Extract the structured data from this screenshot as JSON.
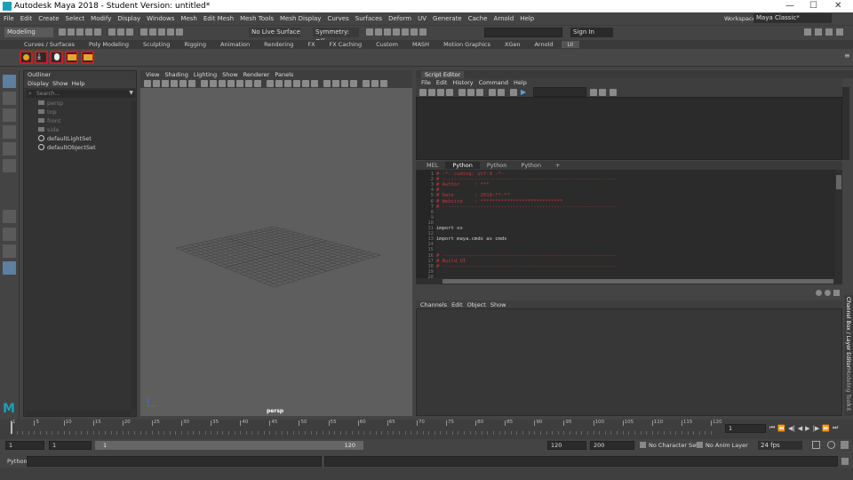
{
  "window": {
    "title": "Autodesk Maya 2018 - Student Version: untitled*"
  },
  "menubar": [
    "File",
    "Edit",
    "Create",
    "Select",
    "Modify",
    "Display",
    "Windows",
    "Mesh",
    "Edit Mesh",
    "Mesh Tools",
    "Mesh Display",
    "Curves",
    "Surfaces",
    "Deform",
    "UV",
    "Generate",
    "Cache",
    "Arnold",
    "Help"
  ],
  "workspace": {
    "label": "Workspace :",
    "value": "Maya Classic*"
  },
  "statusline": {
    "mode": "Modeling",
    "live_surface": "No Live Surface",
    "symmetry": "Symmetry: Off",
    "sign_in": "Sign In"
  },
  "shelf_tabs": [
    "Curves / Surfaces",
    "Poly Modeling",
    "Sculpting",
    "Rigging",
    "Animation",
    "Rendering",
    "FX",
    "FX Caching",
    "Custom",
    "MASH",
    "Motion Graphics",
    "XGen",
    "Arnold",
    "UI"
  ],
  "shelf_active_tab": "UI",
  "outliner": {
    "title": "Outliner",
    "menu": [
      "Display",
      "Show",
      "Help"
    ],
    "search_placeholder": "Search...",
    "items": [
      "persp",
      "top",
      "front",
      "side",
      "defaultLightSet",
      "defaultObjectSet"
    ]
  },
  "viewport": {
    "menu": [
      "View",
      "Shading",
      "Lighting",
      "Show",
      "Renderer",
      "Panels"
    ],
    "camera_label": "persp"
  },
  "script_editor": {
    "title": "Script Editor",
    "menu": [
      "File",
      "Edit",
      "History",
      "Command",
      "Help"
    ],
    "tabs": [
      "MEL",
      "Python",
      "Python",
      "Python",
      "+"
    ],
    "active_tab": 1,
    "line_numbers": [
      "1",
      "2",
      "3",
      "4",
      "5",
      "6",
      "7",
      "8",
      "9",
      "10",
      "11",
      "12",
      "13",
      "14",
      "15",
      "16",
      "17",
      "18",
      "19",
      "20",
      "21"
    ],
    "code": [
      {
        "text": "# -*- coding: utf-8 -*-",
        "color": "red"
      },
      {
        "text": "# -----------------------------------------------------------",
        "color": "red"
      },
      {
        "text": "# Author     : ***",
        "color": "red"
      },
      {
        "text": "#",
        "color": "red"
      },
      {
        "text": "# Date       : 2018-**-**",
        "color": "red"
      },
      {
        "text": "# Website    : ****************************",
        "color": "red"
      },
      {
        "text": "# -----------------------------------------------------------",
        "color": "red"
      },
      {
        "text": "",
        "color": "white"
      },
      {
        "text": "",
        "color": "white"
      },
      {
        "text": "",
        "color": "white"
      },
      {
        "text": "import os",
        "color": "white"
      },
      {
        "text": "",
        "color": "white"
      },
      {
        "text": "import maya.cmds as cmds",
        "color": "white"
      },
      {
        "text": "",
        "color": "white"
      },
      {
        "text": "",
        "color": "white"
      },
      {
        "text": "# -----------------------------------------------------------",
        "color": "red"
      },
      {
        "text": "# Build UI",
        "color": "red"
      },
      {
        "text": "# -----------------------------------------------------------",
        "color": "red"
      }
    ]
  },
  "channel_box": {
    "menu": [
      "Channels",
      "Edit",
      "Object",
      "Show"
    ],
    "side_tabs": [
      "Channel Box / Layer Editor",
      "Modeling Toolkit"
    ]
  },
  "timeline": {
    "ticks": [
      "1",
      "5",
      "10",
      "15",
      "20",
      "25",
      "30",
      "35",
      "40",
      "45",
      "50",
      "55",
      "60",
      "65",
      "70",
      "75",
      "80",
      "85",
      "90",
      "95",
      "100",
      "105",
      "110",
      "115",
      "120"
    ],
    "current_frame": "1"
  },
  "range": {
    "start": "1",
    "playback_start": "1",
    "slider_start": "1",
    "slider_end": "120",
    "playback_end": "120",
    "end": "200",
    "character_set": "No Character Set",
    "anim_layer": "No Anim Layer",
    "fps": "24 fps"
  },
  "cmdline": {
    "label": "Python"
  },
  "colors": {
    "accent": "#5d7fa0",
    "code_red": "#cc3333",
    "shelf_border": "#c52020"
  }
}
